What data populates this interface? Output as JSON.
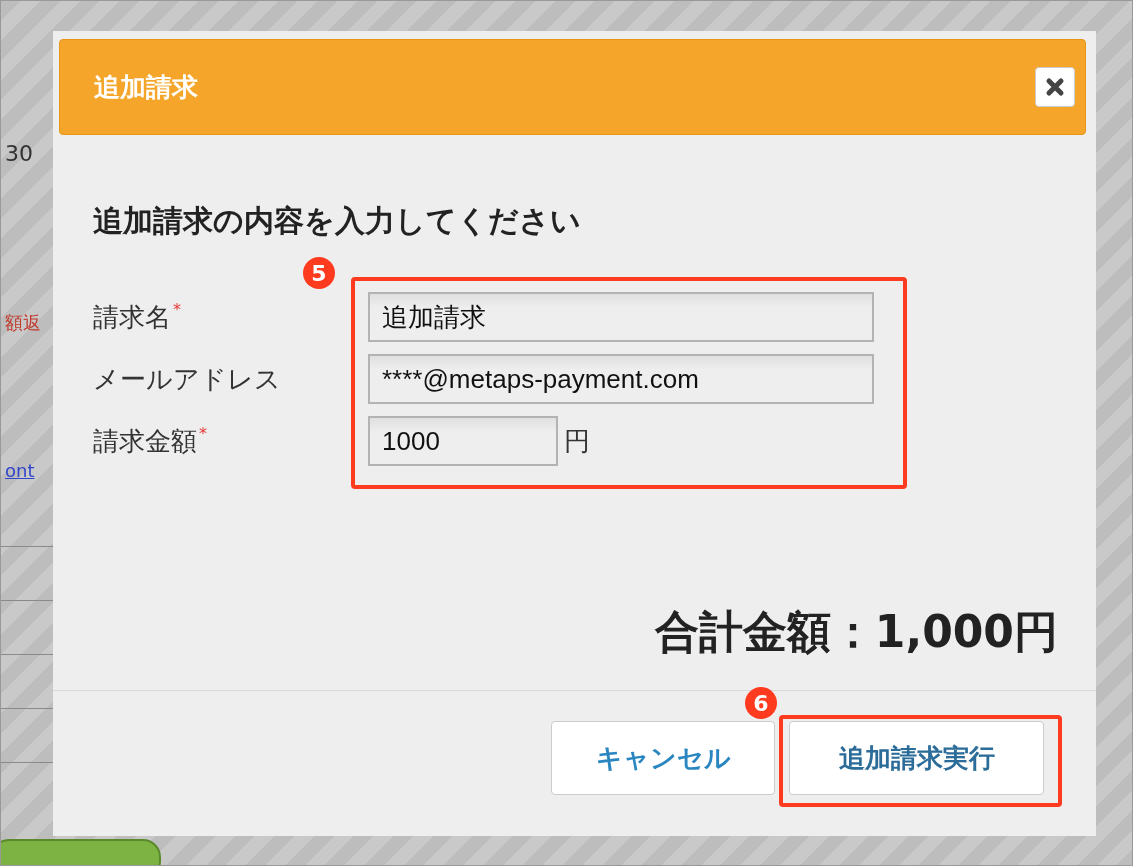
{
  "background": {
    "fragments": [
      {
        "text": "30",
        "kind": "text"
      },
      {
        "text": "額返",
        "kind": "error"
      },
      {
        "text": "ont",
        "kind": "link"
      }
    ]
  },
  "dialog": {
    "title": "追加請求",
    "heading": "追加請求の内容を入力してください",
    "fields": [
      {
        "label": "請求名",
        "mark": "*",
        "value": "追加請求"
      },
      {
        "label": "メールアドレス",
        "value": "****@metaps-payment.com"
      },
      {
        "label": "請求金額",
        "mark": "*",
        "value": "1000",
        "suffix": "円"
      }
    ],
    "total": "合計金額：1,000円",
    "buttons": [
      {
        "label": "キャンセル",
        "kind": "cancel"
      },
      {
        "label": "追加請求実行",
        "kind": "primary"
      }
    ]
  },
  "annotations": [
    {
      "number": "5"
    },
    {
      "number": "6"
    }
  ]
}
